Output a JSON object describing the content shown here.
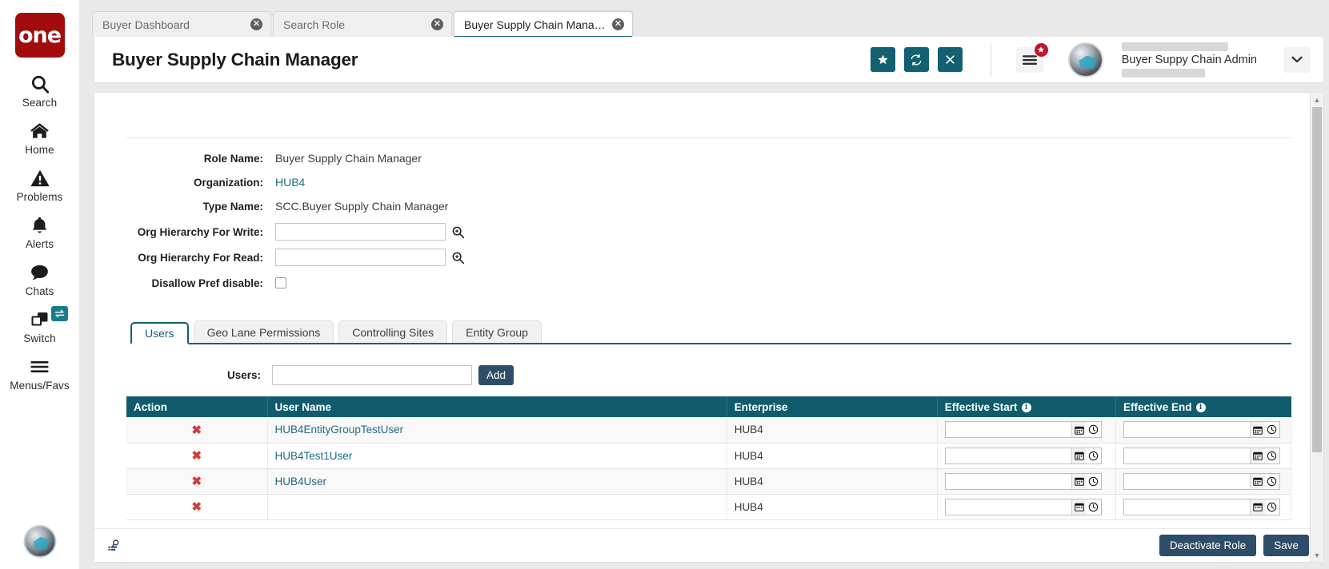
{
  "brand": {
    "logo_text": "one"
  },
  "rail": {
    "items": [
      {
        "label": "Search",
        "icon": "search-icon"
      },
      {
        "label": "Home",
        "icon": "home-icon"
      },
      {
        "label": "Problems",
        "icon": "warning-triangle-icon"
      },
      {
        "label": "Alerts",
        "icon": "bell-icon"
      },
      {
        "label": "Chats",
        "icon": "chat-bubble-icon"
      },
      {
        "label": "Switch",
        "icon": "windows-stack-icon",
        "badge": "switch-arrows-icon"
      },
      {
        "label": "Menus/Favs",
        "icon": "hamburger-icon"
      }
    ]
  },
  "tabs": [
    {
      "title": "Buyer Dashboard",
      "active": false
    },
    {
      "title": "Search Role",
      "active": false
    },
    {
      "title": "Buyer Supply Chain Manager",
      "active": true
    }
  ],
  "header": {
    "title": "Buyer Supply Chain Manager",
    "actions": [
      {
        "name": "favorite-button",
        "glyph": "★"
      },
      {
        "name": "refresh-button",
        "glyph": "↻"
      },
      {
        "name": "close-button",
        "glyph": "✕"
      }
    ],
    "menu_badge": "★",
    "user_role": "Buyer Suppy Chain Admin"
  },
  "form": {
    "fields": [
      {
        "label": "Role Name:",
        "value": "Buyer Supply Chain Manager",
        "type": "text"
      },
      {
        "label": "Organization:",
        "value": "HUB4",
        "type": "link"
      },
      {
        "label": "Type Name:",
        "value": "SCC.Buyer Supply Chain Manager",
        "type": "text"
      },
      {
        "label": "Org Hierarchy For Write:",
        "value": "",
        "type": "lookup"
      },
      {
        "label": "Org Hierarchy For Read:",
        "value": "",
        "type": "lookup"
      },
      {
        "label": "Disallow Pref disable:",
        "value": "",
        "type": "checkbox"
      }
    ]
  },
  "sub_tabs": [
    {
      "label": "Users",
      "active": true
    },
    {
      "label": "Geo Lane Permissions",
      "active": false
    },
    {
      "label": "Controlling Sites",
      "active": false
    },
    {
      "label": "Entity Group",
      "active": false
    }
  ],
  "users_panel": {
    "add_label": "Users:",
    "add_input_value": "",
    "add_button": "Add",
    "columns": [
      {
        "label": "Action",
        "info": false
      },
      {
        "label": "User Name",
        "info": false
      },
      {
        "label": "Enterprise",
        "info": false
      },
      {
        "label": "Effective Start",
        "info": true
      },
      {
        "label": "Effective End",
        "info": true
      }
    ],
    "rows": [
      {
        "action": "✖",
        "user_name": "HUB4EntityGroupTestUser",
        "enterprise": "HUB4",
        "effective_start": "",
        "effective_end": ""
      },
      {
        "action": "✖",
        "user_name": "HUB4Test1User",
        "enterprise": "HUB4",
        "effective_start": "",
        "effective_end": ""
      },
      {
        "action": "✖",
        "user_name": "HUB4User",
        "enterprise": "HUB4",
        "effective_start": "",
        "effective_end": ""
      },
      {
        "action": "✖",
        "user_name": "",
        "enterprise": "HUB4",
        "effective_start": "",
        "effective_end": ""
      }
    ]
  },
  "footer": {
    "icon": "report-search-icon",
    "deactivate_label": "Deactivate Role",
    "save_label": "Save"
  },
  "colors": {
    "brand_red": "#a30c0c",
    "teal": "#136070",
    "table_header": "#115c6c",
    "button_navy": "#2e4d68",
    "link": "#1d6c85",
    "delete_red": "#d8383a",
    "badge_red": "#c1152b"
  }
}
